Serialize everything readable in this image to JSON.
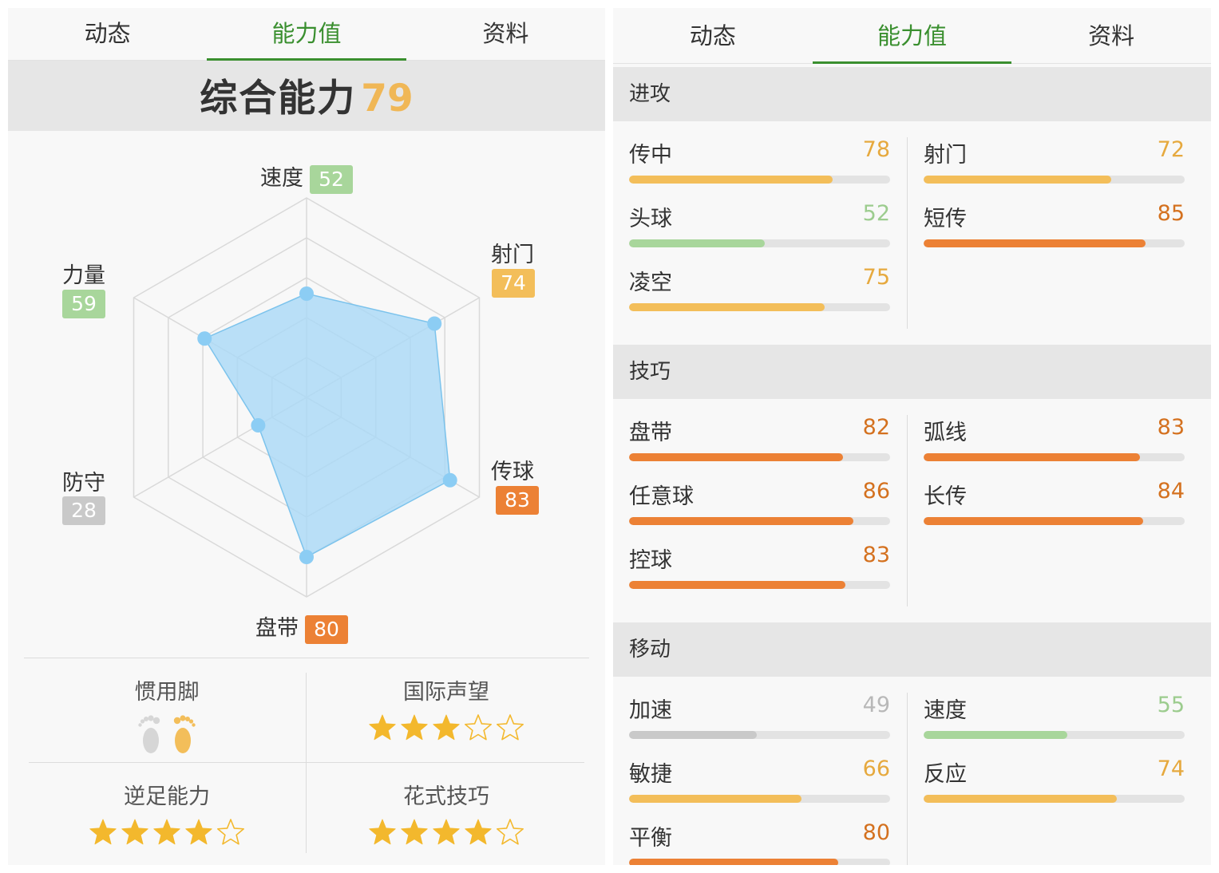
{
  "colors": {
    "accent_green": "#3a8f2f",
    "orange": "#ec8135",
    "yellow": "#f3be5a",
    "green": "#a8d69b",
    "gray": "#c9c9c9",
    "radar_fill": "#a9d8f6",
    "radar_point": "#8ccdf4",
    "overall_value": "#f0b756"
  },
  "left": {
    "tabs": [
      "动态",
      "能力值",
      "资料"
    ],
    "active_tab": 1,
    "overall": {
      "label": "综合能力",
      "value": "79"
    },
    "radar": {
      "axes": [
        {
          "name": "速度",
          "value": 52,
          "color": "green"
        },
        {
          "name": "射门",
          "value": 74,
          "color": "yellow"
        },
        {
          "name": "传球",
          "value": 83,
          "color": "orange"
        },
        {
          "name": "盘带",
          "value": 80,
          "color": "orange"
        },
        {
          "name": "防守",
          "value": 28,
          "color": "gray"
        },
        {
          "name": "力量",
          "value": 59,
          "color": "green"
        }
      ],
      "max": 100
    },
    "attributes": {
      "preferred_foot": {
        "label": "惯用脚",
        "left_icon": "left-foot-icon",
        "right_icon": "right-foot-icon",
        "right_active": true
      },
      "reputation": {
        "label": "国际声望",
        "stars": 3,
        "max": 5
      },
      "weak_foot": {
        "label": "逆足能力",
        "stars": 4,
        "max": 5
      },
      "skill_moves": {
        "label": "花式技巧",
        "stars": 4,
        "max": 5
      }
    }
  },
  "right": {
    "tabs": [
      "动态",
      "能力值",
      "资料"
    ],
    "active_tab": 1,
    "sections": [
      {
        "title": "进攻",
        "left": [
          {
            "name": "传中",
            "value": 78,
            "color": "yellow"
          },
          {
            "name": "头球",
            "value": 52,
            "color": "green"
          },
          {
            "name": "凌空",
            "value": 75,
            "color": "yellow"
          }
        ],
        "right": [
          {
            "name": "射门",
            "value": 72,
            "color": "yellow"
          },
          {
            "name": "短传",
            "value": 85,
            "color": "orange"
          }
        ]
      },
      {
        "title": "技巧",
        "left": [
          {
            "name": "盘带",
            "value": 82,
            "color": "orange"
          },
          {
            "name": "任意球",
            "value": 86,
            "color": "orange"
          },
          {
            "name": "控球",
            "value": 83,
            "color": "orange"
          }
        ],
        "right": [
          {
            "name": "弧线",
            "value": 83,
            "color": "orange"
          },
          {
            "name": "长传",
            "value": 84,
            "color": "orange"
          }
        ]
      },
      {
        "title": "移动",
        "left": [
          {
            "name": "加速",
            "value": 49,
            "color": "gray"
          },
          {
            "name": "敏捷",
            "value": 66,
            "color": "yellow"
          },
          {
            "name": "平衡",
            "value": 80,
            "color": "orange"
          }
        ],
        "right": [
          {
            "name": "速度",
            "value": 55,
            "color": "green"
          },
          {
            "name": "反应",
            "value": 74,
            "color": "yellow"
          }
        ]
      }
    ]
  }
}
